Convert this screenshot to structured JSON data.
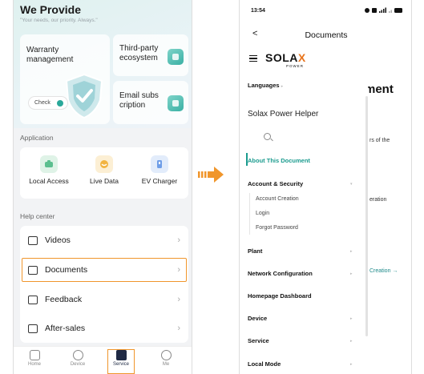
{
  "left": {
    "title": "We Provide",
    "subtitle": "\"Your needs, our priority. Always.\"",
    "cards": {
      "warranty": "Warranty management",
      "check": "Check",
      "third_party": "Third-party ecosystem",
      "email": "Email subs cription"
    },
    "application_label": "Application",
    "apps": [
      {
        "label": "Local Access",
        "icon": "local-access-icon",
        "color": "#5cbf8f"
      },
      {
        "label": "Live Data",
        "icon": "live-data-icon",
        "color": "#f2b441"
      },
      {
        "label": "EV Charger",
        "icon": "ev-charger-icon",
        "color": "#6f9ee8"
      }
    ],
    "help_label": "Help center",
    "help_items": [
      {
        "label": "Videos"
      },
      {
        "label": "Documents"
      },
      {
        "label": "Feedback"
      },
      {
        "label": "After-sales"
      }
    ],
    "tabs": [
      {
        "label": "Home"
      },
      {
        "label": "Device"
      },
      {
        "label": "Service"
      },
      {
        "label": "Me"
      }
    ],
    "highlight_color": "#f0962c"
  },
  "right": {
    "status_time": "13:54",
    "nav_title": "Documents",
    "back_glyph": "<",
    "logo": {
      "main_a": "SOLA",
      "main_b": "X",
      "sub": "POWER"
    },
    "bg_heading": "ment",
    "bg_text1": "rs of the",
    "bg_text2": "eration",
    "bg_link": "Creation →",
    "sidebar": {
      "languages": "Languages",
      "helper": "Solax Power Helper",
      "about": "About This Document",
      "account": "Account & Security",
      "account_sub": [
        "Account Creation",
        "Login",
        "Forgot Password"
      ],
      "plant": "Plant",
      "network": "Network Configuration",
      "homepage": "Homepage Dashboard",
      "device": "Device",
      "service": "Service",
      "local": "Local Mode"
    },
    "accent_color": "#1a9b8e"
  }
}
